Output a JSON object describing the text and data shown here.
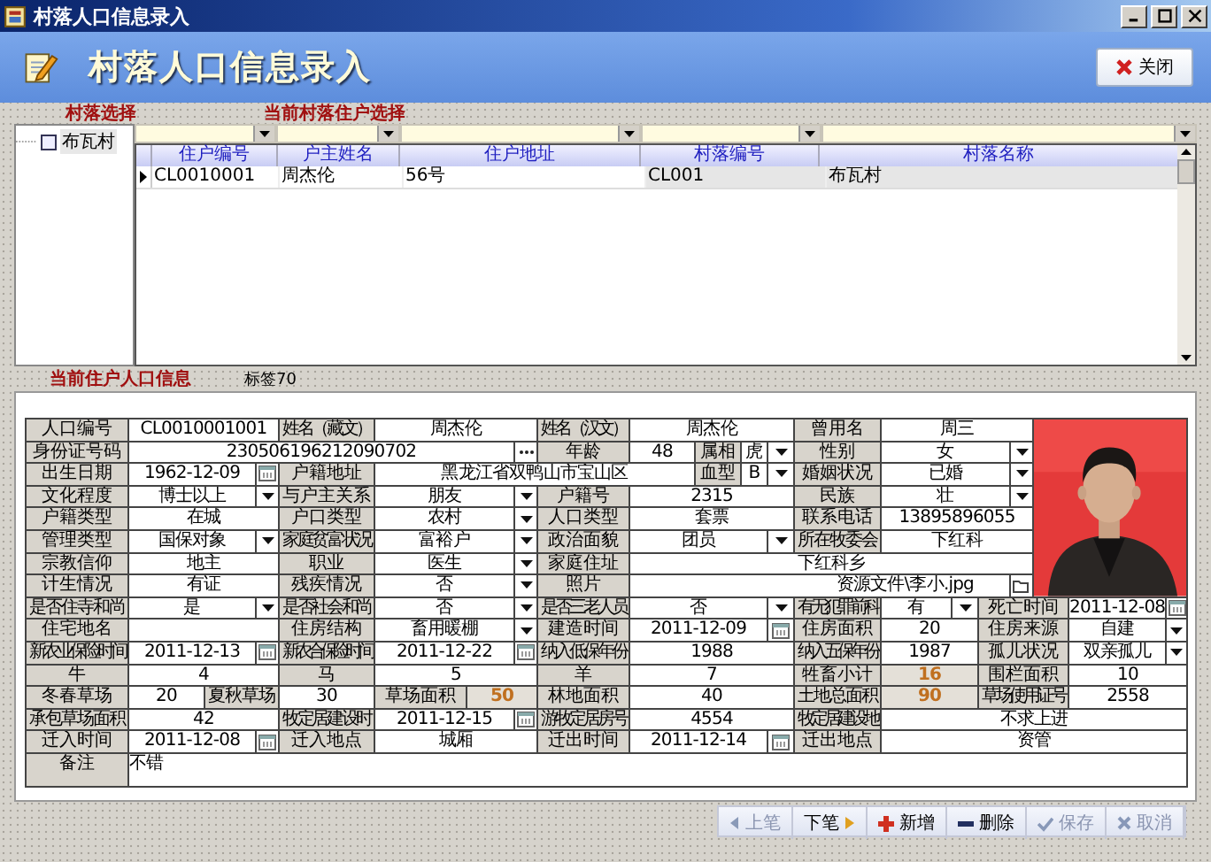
{
  "window": {
    "title": "村落人口信息录入"
  },
  "header": {
    "title": "村落人口信息录入",
    "close_button": "关闭"
  },
  "village_panel": {
    "label": "村落选择",
    "tree": [
      {
        "label": "布瓦村",
        "checked": false
      }
    ]
  },
  "household_panel": {
    "label": "当前村落住户选择",
    "columns": [
      "住户编号",
      "户主姓名",
      "住户地址",
      "村落编号",
      "村落名称"
    ],
    "rows": [
      {
        "cells": [
          "CL0010001",
          "周杰伦",
          "56号",
          "CL001",
          "布瓦村"
        ],
        "selected": true
      }
    ]
  },
  "person": {
    "label": "当前住户人口信息",
    "tag": "标签70",
    "lines": [
      [
        {
          "label": "人口编号",
          "value": "CL0010001001",
          "kind": "text"
        },
        {
          "label": "姓名（藏文）",
          "value": "周杰伦",
          "kind": "text"
        },
        {
          "label": "姓名（汉文）",
          "value": "周杰伦",
          "kind": "text"
        },
        {
          "label": "曾用名",
          "value": "周三",
          "kind": "text"
        }
      ],
      [
        {
          "label": "身份证号码",
          "value": "230506196212090702",
          "kind": "lookup"
        },
        {
          "label": "年龄",
          "value": "48",
          "kind": "text"
        },
        {
          "label": "属相",
          "value": "虎",
          "kind": "select"
        },
        {
          "label": "性别",
          "value": "女",
          "kind": "select"
        }
      ],
      [
        {
          "label": "出生日期",
          "value": "1962-12-09",
          "kind": "date"
        },
        {
          "label": "户籍地址",
          "value": "黑龙江省双鸭山市宝山区",
          "kind": "text"
        },
        {
          "label": "血型",
          "value": "B",
          "kind": "select"
        },
        {
          "label": "婚姻状况",
          "value": "已婚",
          "kind": "select"
        }
      ],
      [
        {
          "label": "文化程度",
          "value": "博士以上",
          "kind": "select"
        },
        {
          "label": "与户主关系",
          "value": "朋友",
          "kind": "select"
        },
        {
          "label": "户籍号",
          "value": "2315",
          "kind": "text"
        },
        {
          "label": "民族",
          "value": "壮",
          "kind": "select"
        }
      ],
      [
        {
          "label": "户籍类型",
          "value": "在城",
          "kind": "text"
        },
        {
          "label": "户口类型",
          "value": "农村",
          "kind": "select"
        },
        {
          "label": "人口类型",
          "value": "套票",
          "kind": "text"
        },
        {
          "label": "联系电话",
          "value": "13895896055",
          "kind": "text"
        }
      ],
      [
        {
          "label": "管理类型",
          "value": "国保对象",
          "kind": "select"
        },
        {
          "label": "家庭贫富状况",
          "value": "富裕户",
          "kind": "select"
        },
        {
          "label": "政治面貌",
          "value": "团员",
          "kind": "select"
        },
        {
          "label": "所在牧委会",
          "value": "下红科",
          "kind": "text"
        }
      ],
      [
        {
          "label": "宗教信仰",
          "value": "地主",
          "kind": "text"
        },
        {
          "label": "职业",
          "value": "医生",
          "kind": "select"
        },
        {
          "label": "家庭住址",
          "value": "下红科乡",
          "kind": "text"
        }
      ],
      [
        {
          "label": "计生情况",
          "value": "有证",
          "kind": "text"
        },
        {
          "label": "残疾情况",
          "value": "否",
          "kind": "select"
        },
        {
          "label": "照片",
          "value": "资源文件\\李小.jpg",
          "kind": "file"
        }
      ],
      [
        {
          "label": "是否住寺和尚",
          "value": "是",
          "kind": "select"
        },
        {
          "label": "是否社会和尚",
          "value": "否",
          "kind": "select"
        },
        {
          "label": "是否三老人员",
          "value": "否",
          "kind": "select"
        },
        {
          "label": "有无犯罪前科",
          "value": "有",
          "kind": "select"
        },
        {
          "label": "死亡时间",
          "value": "2011-12-08",
          "kind": "date"
        }
      ],
      [
        {
          "label": "住宅地名",
          "kind": "text"
        },
        {
          "label": "住房结构",
          "value": "畜用暖棚",
          "kind": "select"
        },
        {
          "label": "建造时间",
          "value": "2011-12-09",
          "kind": "date"
        },
        {
          "label": "住房面积",
          "value": "20",
          "kind": "text"
        },
        {
          "label": "住房来源",
          "value": "自建",
          "kind": "select"
        }
      ],
      [
        {
          "label": "新农业保险时间",
          "value": "2011-12-13",
          "kind": "date"
        },
        {
          "label": "新农合保险时间",
          "value": "2011-12-22",
          "kind": "date"
        },
        {
          "label": "纳入低保年份",
          "value": "1988",
          "kind": "text"
        },
        {
          "label": "纳入五保年份",
          "value": "1987",
          "kind": "text"
        },
        {
          "label": "孤儿状况",
          "value": "双亲孤儿",
          "kind": "select"
        }
      ],
      [
        {
          "label": "牛",
          "value": "4",
          "kind": "text"
        },
        {
          "label": "马",
          "value": "5",
          "kind": "text"
        },
        {
          "label": "羊",
          "value": "7",
          "kind": "text"
        },
        {
          "label": "牲畜小计",
          "value": "16",
          "kind": "computed"
        },
        {
          "label": "围栏面积",
          "value": "10",
          "kind": "text"
        }
      ],
      [
        {
          "label": "冬春草场",
          "value": "20",
          "kind": "text"
        },
        {
          "label": "夏秋草场",
          "value": "30",
          "kind": "text"
        },
        {
          "label": "草场面积",
          "value": "50",
          "kind": "computed"
        },
        {
          "label": "林地面积",
          "value": "40",
          "kind": "text"
        },
        {
          "label": "土地总面积",
          "value": "90",
          "kind": "computed"
        },
        {
          "label": "草场使用证号",
          "value": "2558",
          "kind": "text"
        }
      ],
      [
        {
          "label": "承包草场面积",
          "value": "42",
          "kind": "text"
        },
        {
          "label": "牧定居建设时",
          "value": "2011-12-15",
          "kind": "date"
        },
        {
          "label": "游牧定居房号",
          "value": "4554",
          "kind": "text"
        },
        {
          "label": "牧定居建设地",
          "value": "不求上进",
          "kind": "text"
        }
      ],
      [
        {
          "label": "迁入时间",
          "value": "2011-12-08",
          "kind": "date"
        },
        {
          "label": "迁入地点",
          "value": "城厢",
          "kind": "text"
        },
        {
          "label": "迁出时间",
          "value": "2011-12-14",
          "kind": "date"
        },
        {
          "label": "迁出地点",
          "value": "资管",
          "kind": "text"
        }
      ]
    ],
    "remarks": {
      "label": "备注",
      "value": "不错"
    }
  },
  "buttons": [
    {
      "label": "上笔",
      "kind": "prev",
      "disabled": true
    },
    {
      "label": "下笔",
      "kind": "next",
      "disabled": false
    },
    {
      "label": "新增",
      "kind": "add",
      "disabled": false
    },
    {
      "label": "删除",
      "kind": "delete",
      "disabled": false
    },
    {
      "label": "保存",
      "kind": "save",
      "disabled": true
    },
    {
      "label": "取消",
      "kind": "cancel",
      "disabled": true
    }
  ]
}
